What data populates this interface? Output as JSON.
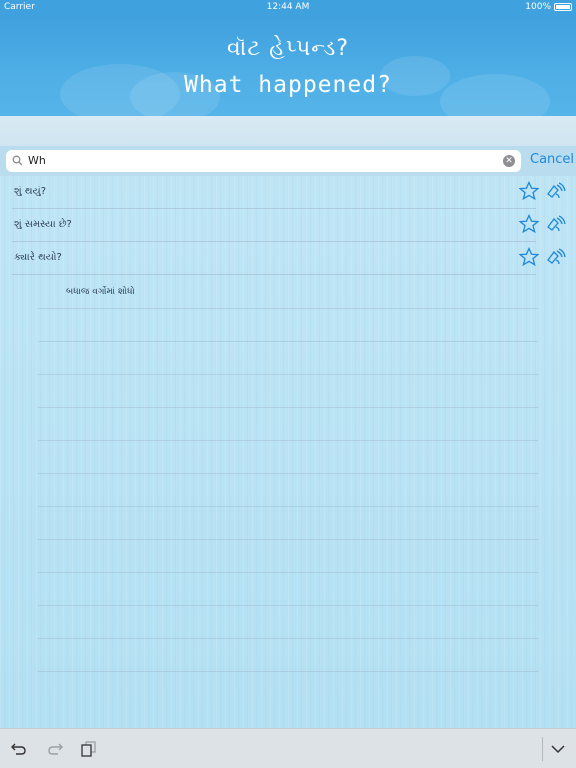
{
  "status_bar": {
    "carrier": "Carrier",
    "time": "12:44 AM",
    "battery": "100%"
  },
  "header": {
    "title_gujarati": "વૉટ હેપ્પન્ડ?",
    "title_english": "What happened?"
  },
  "search": {
    "value": "Wh",
    "cancel_label": "Cancel"
  },
  "results": [
    {
      "text": "શું થયું?"
    },
    {
      "text": "શું સમસ્યા છે?"
    },
    {
      "text": "ક્યારે થયો?"
    }
  ],
  "search_all_label": "બધાજ વર્ગોમાં શોધો",
  "colors": {
    "header": "#3fa2df",
    "accent": "#1e88d8",
    "background": "#bfe6f5"
  },
  "icons": [
    "wifi-icon",
    "battery-icon",
    "search-icon",
    "clear-icon",
    "star-icon",
    "sound-icon",
    "undo-icon",
    "redo-icon",
    "paste-icon",
    "chevron-down-icon"
  ]
}
